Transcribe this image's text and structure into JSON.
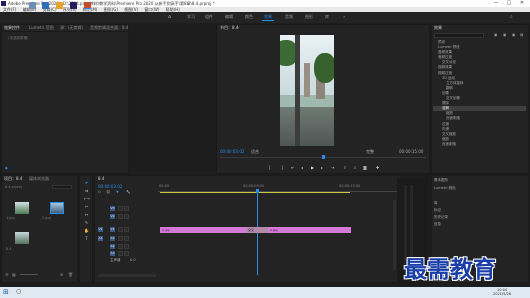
{
  "window": {
    "title": "Adobe Premiere Pro 2020 - D:\\2304.pr\\pr教材\\教学资料\\Premiere Pro 2020 从新手到高手\\第8章\\8.4.prproj *",
    "minimize": "—",
    "maximize": "□",
    "close": "✕"
  },
  "menu": [
    "文件(F)",
    "编辑(E)",
    "剪辑(C)",
    "序列(S)",
    "标记(M)",
    "图形(G)",
    "视图(V)",
    "窗口(W)",
    "帮助(H)"
  ],
  "workspaces": [
    "学习",
    "组件",
    "编辑",
    "颜色",
    "效果",
    "音频",
    "图形",
    "库"
  ],
  "workspaces_active": "效果",
  "source_panel": {
    "tabs": [
      "效果控件",
      "Lumetri 范围",
      "源：(无剪辑)",
      "音频剪辑混合器：8.4"
    ],
    "empty_text": "（未选择剪辑）"
  },
  "program_monitor": {
    "title": "节目：8.4",
    "menu": "≡",
    "timecode_left": "00:00:03:02",
    "fit": "适合",
    "quality": "完整",
    "timecode_right": "00:00:15:00"
  },
  "project_panel": {
    "tabs": [
      "项目：8.4",
      "媒体浏览器"
    ],
    "file": "8.4.prproj",
    "items": [
      "1.jpg",
      "2.jpg",
      "8.4"
    ]
  },
  "timeline": {
    "timecode": "00:00:03:02",
    "ruler_start": "00:00",
    "ruler_mid": "00:00:05:00",
    "ruler_end": "00:00:10:00",
    "tracks": [
      "V3",
      "V2",
      "V1",
      "A1",
      "A2",
      "A3",
      "主声道"
    ],
    "master_value": "0.0",
    "clips": [
      "1.jpg",
      "2.jpg"
    ],
    "transition_label": "交叉"
  },
  "effects_panel": {
    "title": "效果",
    "tree": [
      "预设",
      "Lumetri 预设",
      "音频效果",
      "音频过渡",
      "交叉淡化",
      "视频效果",
      "视频过渡",
      "3D 运动",
      "立方体旋转",
      "翻转",
      "划像",
      "交叉划像",
      "擦除",
      "沉浸式视频",
      "溶解",
      "缩放",
      "页面剥落",
      "过渡",
      "内滑",
      "交叉缩放",
      "缩放",
      "页面剥落"
    ],
    "highlighted": "溶解"
  },
  "right_lower_panel": {
    "items": [
      "基本图形",
      "Lumetri 颜色",
      "库",
      "标记",
      "历史记录",
      "信息"
    ]
  },
  "taskbar": {
    "search_icon": "search-icon",
    "time": "10:04",
    "date": "2021/5/26"
  },
  "watermark": "最需教育",
  "colors": {
    "accent": "#2d8ceb",
    "clip": "#d37ad6",
    "watermark": "#1a3ea8"
  }
}
